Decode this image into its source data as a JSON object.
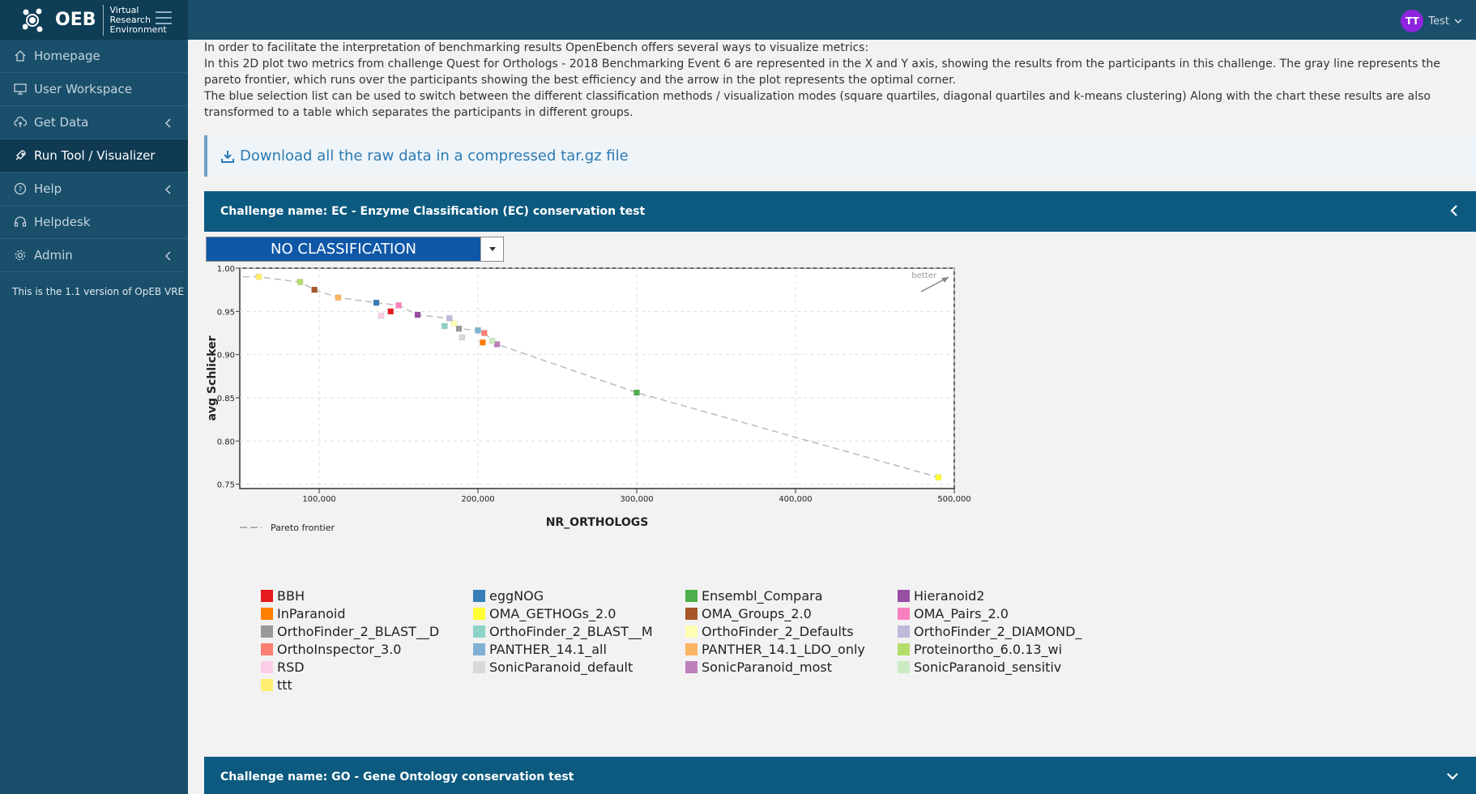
{
  "app": {
    "logo_text": "OEB",
    "logo_lines": [
      "Virtual",
      "Research",
      "Environment"
    ]
  },
  "sidebar": {
    "items": [
      {
        "label": "Homepage",
        "icon": "home-icon"
      },
      {
        "label": "User Workspace",
        "icon": "monitor-icon"
      },
      {
        "label": "Get Data",
        "icon": "cloud-upload-icon"
      },
      {
        "label": "Run Tool / Visualizer",
        "icon": "rocket-icon"
      },
      {
        "label": "Help",
        "icon": "question-circle-icon"
      },
      {
        "label": "Helpdesk",
        "icon": "headset-icon"
      },
      {
        "label": "Admin",
        "icon": "gear-icon"
      }
    ],
    "version_note": "This is the 1.1 version of OpEB VRE"
  },
  "user": {
    "initials": "TT",
    "name": "Test"
  },
  "intro": {
    "line1": "In order to facilitate the interpretation of benchmarking results OpenEbench offers several ways to visualize metrics:",
    "line2": "In this 2D plot two metrics from challenge Quest for Orthologs - 2018 Benchmarking Event 6 are represented in the X and Y axis, showing the results from the participants in this challenge. The gray line represents the pareto frontier, which runs over the participants showing the best efficiency and the arrow in the plot represents the optimal corner.",
    "line3": "The blue selection list can be used to switch between the different classification methods / visualization modes (square quartiles, diagonal quartiles and k-means clustering) Along with the chart these results are also transformed to a table which separates the participants in different groups."
  },
  "download": {
    "label": "Download all the raw data in a compressed tar.gz file"
  },
  "panel1": {
    "title": "Challenge name: EC - Enzyme Classification (EC) conservation test"
  },
  "panel2": {
    "title": "Challenge name: GO - Gene Ontology conservation test"
  },
  "classification": {
    "selected": "NO CLASSIFICATION"
  },
  "chart_data": {
    "type": "scatter",
    "xlabel": "NR_ORTHOLOGS",
    "ylabel": "avg Schlicker",
    "xlim": [
      50000,
      500000
    ],
    "ylim": [
      0.745,
      1.0
    ],
    "xticks": [
      100000,
      200000,
      300000,
      400000,
      500000
    ],
    "xtick_labels": [
      "100,000",
      "200,000",
      "300,000",
      "400,000",
      "500,000"
    ],
    "yticks": [
      0.75,
      0.8,
      0.85,
      0.9,
      0.95,
      1.0
    ],
    "ytick_labels": [
      "0.75",
      "0.80",
      "0.85",
      "0.90",
      "0.95",
      "1.00"
    ],
    "grid": true,
    "annotation": "better",
    "pareto_label": "Pareto frontier",
    "pareto": [
      [
        52000,
        0.99
      ],
      [
        62000,
        0.99
      ],
      [
        88000,
        0.984
      ],
      [
        97000,
        0.975
      ],
      [
        112000,
        0.966
      ],
      [
        136000,
        0.96
      ],
      [
        150000,
        0.957
      ],
      [
        162000,
        0.946
      ],
      [
        182000,
        0.942
      ],
      [
        188000,
        0.93
      ],
      [
        200000,
        0.928
      ],
      [
        204000,
        0.925
      ],
      [
        212000,
        0.912
      ],
      [
        300000,
        0.856
      ],
      [
        490000,
        0.758
      ]
    ],
    "series": [
      {
        "name": "BBH",
        "color": "#e41a1c",
        "x": 145000,
        "y": 0.95
      },
      {
        "name": "eggNOG",
        "color": "#377eb8",
        "x": 136000,
        "y": 0.96
      },
      {
        "name": "Ensembl_Compara",
        "color": "#4daf4a",
        "x": 300000,
        "y": 0.856
      },
      {
        "name": "Hieranoid2",
        "color": "#984ea3",
        "x": 162000,
        "y": 0.946
      },
      {
        "name": "InParanoid",
        "color": "#ff7f00",
        "x": 203000,
        "y": 0.914
      },
      {
        "name": "OMA_GETHOGs_2.0",
        "color": "#ffff33",
        "x": 490000,
        "y": 0.758
      },
      {
        "name": "OMA_Groups_2.0",
        "color": "#a65628",
        "x": 97000,
        "y": 0.975
      },
      {
        "name": "OMA_Pairs_2.0",
        "color": "#f781bf",
        "x": 150000,
        "y": 0.957
      },
      {
        "name": "OrthoFinder_2_BLAST__D",
        "color": "#999999",
        "x": 188000,
        "y": 0.93
      },
      {
        "name": "OrthoFinder_2_BLAST__M",
        "color": "#8dd3c7",
        "x": 179000,
        "y": 0.933
      },
      {
        "name": "OrthoFinder_2_Defaults",
        "color": "#ffffb3",
        "x": 185000,
        "y": 0.936
      },
      {
        "name": "OrthoFinder_2_DIAMOND_",
        "color": "#bebada",
        "x": 182000,
        "y": 0.942
      },
      {
        "name": "OrthoInspector_3.0",
        "color": "#fb8072",
        "x": 204000,
        "y": 0.925
      },
      {
        "name": "PANTHER_14.1_all",
        "color": "#80b1d3",
        "x": 200000,
        "y": 0.928
      },
      {
        "name": "PANTHER_14.1_LDO_only",
        "color": "#fdb462",
        "x": 112000,
        "y": 0.966
      },
      {
        "name": "Proteinortho_6.0.13_wi",
        "color": "#b3de69",
        "x": 88000,
        "y": 0.984
      },
      {
        "name": "RSD",
        "color": "#fccde5",
        "x": 139000,
        "y": 0.945
      },
      {
        "name": "SonicParanoid_default",
        "color": "#d9d9d9",
        "x": 190000,
        "y": 0.92
      },
      {
        "name": "SonicParanoid_most",
        "color": "#bc80bd",
        "x": 212000,
        "y": 0.912
      },
      {
        "name": "SonicParanoid_sensitiv",
        "color": "#ccebc5",
        "x": 209000,
        "y": 0.916
      },
      {
        "name": "ttt",
        "color": "#ffed6f",
        "x": 62000,
        "y": 0.99
      }
    ]
  }
}
